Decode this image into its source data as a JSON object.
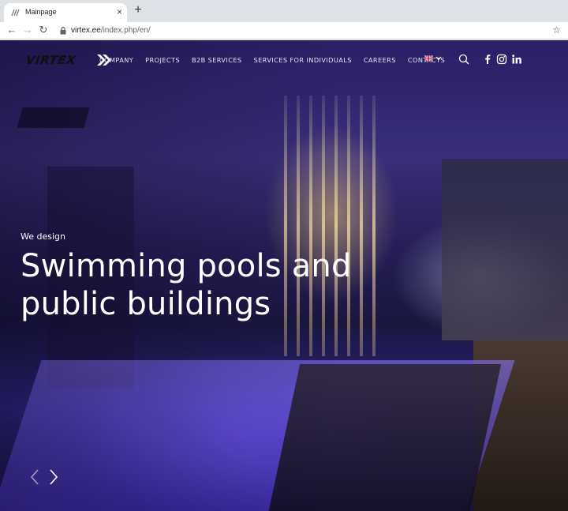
{
  "browser": {
    "tab_title": "Mainpage",
    "tab_close": "×",
    "new_tab": "+",
    "url_host": "virtex.ee",
    "url_path": "/index.php/en/"
  },
  "site": {
    "logo_text": "VIRTEX",
    "menu": [
      "COMPANY",
      "PROJECTS",
      "B2B SERVICES",
      "SERVICES FOR INDIVIDUALS",
      "CAREERS",
      "CONTACTS"
    ],
    "icons": [
      "search-icon",
      "facebook-icon",
      "instagram-icon",
      "linkedin-icon"
    ]
  },
  "hero": {
    "kicker": "We design",
    "title_line1": "Swimming pools and",
    "title_line2": "public buildings"
  }
}
